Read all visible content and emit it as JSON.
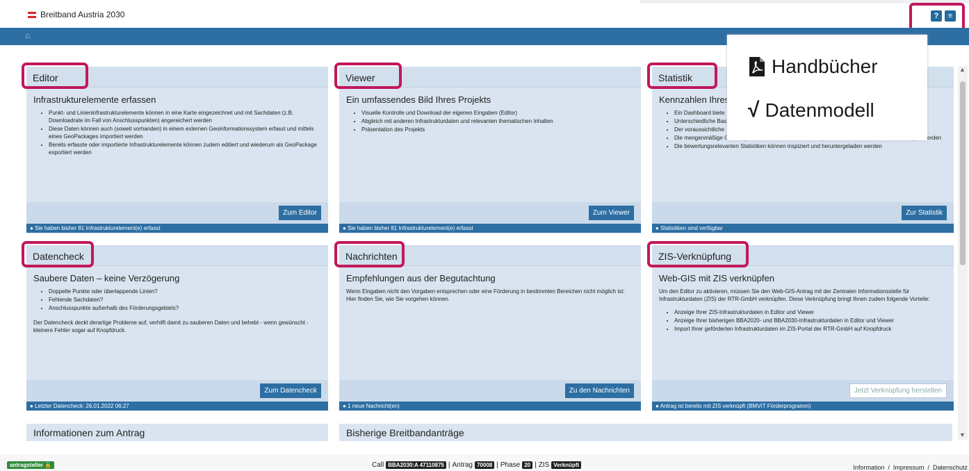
{
  "header": {
    "brand": "Breitband Austria 2030",
    "help_icon": "?",
    "menu_icon": "≡"
  },
  "cards": {
    "editor": {
      "title": "Editor",
      "subtitle": "Infrastrukturelemente erfassen",
      "bullets": [
        "Punkt- und Linieninfrastrukturelemente können in eine Karte eingezeichnet und mit Sachdaten (z.B. Downloadrate im Fall von Anschlusspunkten) angereichert werden",
        "Diese Daten können auch (soweit vorhanden) in einem externen Geoinformationssystem erfasst und mittels eines GeoPackages importiert werden",
        "Bereits erfasste oder importierte Infrastrukturelemente können zudem editiert und wiederum als GeoPackage exportiert werden"
      ],
      "button": "Zum Editor",
      "status": "Sie haben bisher 81 Infrastrukturelement(e) erfasst"
    },
    "viewer": {
      "title": "Viewer",
      "subtitle": "Ein umfassendes Bild Ihres Projekts",
      "bullets": [
        "Visuelle Kontrolle und Download der eigenen Eingaben (Editor)",
        "Abgleich mit anderen Infrastrukturdaten und relevanten thematischen Inhalten",
        "Präsentation des Projekts"
      ],
      "button": "Zum Viewer",
      "status": "Sie haben bisher 81 Infrastrukturelement(e) erfasst"
    },
    "statistik": {
      "title": "Statistik",
      "subtitle": "Kennzahlen Ihres",
      "bullets": [
        "Ein Dashboard biete",
        "Unterschiedliche Bas",
        "Der voraussichtliche",
        "Die mengenmäßige Grundlage für die FFG eCall-Kosteneingabe auf Gemeindeebene kann bezogen werden",
        "Die bewertungsrelevanten Statistiken können inspiziert und heruntergeladen werden"
      ],
      "button": "Zur Statistik",
      "status": "Statistiken sind verfügbar"
    },
    "datencheck": {
      "title": "Datencheck",
      "subtitle": "Saubere Daten – keine Verzögerung",
      "bullets": [
        "Doppelte Punkte oder überlappende Linien?",
        "Fehlende Sachdaten?",
        "Anschlusspunkte außerhalb des Förderungsgebiets?"
      ],
      "text": "Der Datencheck deckt derartige Probleme auf, verhilft damit zu sauberen Daten und behebt - wenn gewünscht - kleinere Fehler sogar auf Knopfdruck.",
      "button": "Zum Datencheck",
      "status": "Letzter Datencheck: 26.01.2022 06:27"
    },
    "nachrichten": {
      "title": "Nachrichten",
      "subtitle": "Empfehlungen aus der Begutachtung",
      "text": "Wenn Eingaben nicht den Vorgaben entsprechen oder eine Förderung in bestimmten Bereichen nicht möglich ist: Hier finden Sie, wie Sie vorgehen können.",
      "button": "Zu den Nachrichten",
      "status": "1 neue Nachricht(en)"
    },
    "zis": {
      "title": "ZIS-Verknüpfung",
      "subtitle": "Web-GIS mit ZIS verknüpfen",
      "text": "Um den Editor zu aktivieren, müssen Sie den Web-GIS-Antrag mit der Zentralen Informationsstelle für Infrastrukturdaten (ZIS) der RTR-GmbH verknüpfen. Diese Verknüpfung bringt Ihnen zudem folgende Vorteile:",
      "bullets": [
        "Anzeige Ihrer ZIS-Infrastrukturdaten in Editor und Viewer",
        "Anzeige Ihrer bisherigen BBA2020- und BBA2030-Infrastrukturdaten in Editor und Viewer",
        "Import Ihrer geförderten Infrastrukturdaten im ZIS-Portal der RTR-GmbH auf Knopfdruck"
      ],
      "button": "Jetzt Verknüpfung herstellen",
      "status": "Antrag ist bereits mit ZIS verknüpft (BMVIT Förderprogramm)"
    },
    "antrag": {
      "title": "Informationen zum Antrag"
    },
    "bisherige": {
      "title": "Bisherige Breitbandanträge"
    }
  },
  "popup": {
    "handbuecher": "Handbücher",
    "datenmodell": "Datenmodell"
  },
  "footer": {
    "role_badge": "antragsteller",
    "call_label": "Call",
    "call_value": "BBA2030:A 47110875",
    "antrag_label": "Antrag",
    "antrag_value": "70008",
    "phase_label": "Phase",
    "phase_value": "20",
    "zis_label": "ZIS",
    "zis_value": "Verknüpft",
    "sep": "|",
    "links": [
      "Information",
      "Impressum",
      "Datenschutz"
    ],
    "link_sep": "/"
  }
}
